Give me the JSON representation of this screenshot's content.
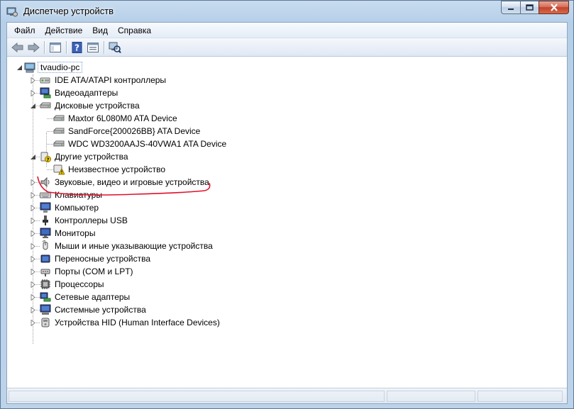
{
  "window": {
    "title": "Диспетчер устройств"
  },
  "menu": [
    "Файл",
    "Действие",
    "Вид",
    "Справка"
  ],
  "tree": {
    "root": "tvaudio-pc",
    "categories": [
      {
        "label": "IDE ATA/ATAPI контроллеры",
        "icon": "ide-controller-icon",
        "expanded": false
      },
      {
        "label": "Видеоадаптеры",
        "icon": "display-adapter-icon",
        "expanded": false
      },
      {
        "label": "Дисковые устройства",
        "icon": "disk-drive-icon",
        "expanded": true,
        "children": [
          "Maxtor 6L080M0 ATA Device",
          "SandForce{200026BB} ATA Device",
          "WDC WD3200AAJS-40VWA1 ATA Device"
        ]
      },
      {
        "label": "Другие устройства",
        "icon": "other-devices-icon",
        "expanded": true,
        "children": [
          "Неизвестное устройство"
        ]
      },
      {
        "label": "Звуковые, видео и игровые устройства",
        "icon": "speaker-icon",
        "expanded": false
      },
      {
        "label": "Клавиатуры",
        "icon": "keyboard-icon",
        "expanded": false
      },
      {
        "label": "Компьютер",
        "icon": "computer-icon",
        "expanded": false
      },
      {
        "label": "Контроллеры USB",
        "icon": "usb-icon",
        "expanded": false
      },
      {
        "label": "Мониторы",
        "icon": "monitor-icon",
        "expanded": false
      },
      {
        "label": "Мыши и иные указывающие устройства",
        "icon": "mouse-icon",
        "expanded": false
      },
      {
        "label": "Переносные устройства",
        "icon": "portable-device-icon",
        "expanded": false
      },
      {
        "label": "Порты (COM и LPT)",
        "icon": "port-icon",
        "expanded": false
      },
      {
        "label": "Процессоры",
        "icon": "processor-icon",
        "expanded": false
      },
      {
        "label": "Сетевые адаптеры",
        "icon": "network-adapter-icon",
        "expanded": false
      },
      {
        "label": "Системные устройства",
        "icon": "system-device-icon",
        "expanded": false
      },
      {
        "label": "Устройства HID (Human Interface Devices)",
        "icon": "hid-icon",
        "expanded": false
      }
    ]
  },
  "colors": {
    "annotation": "#e0102a",
    "accent": "#3a6ea5"
  }
}
